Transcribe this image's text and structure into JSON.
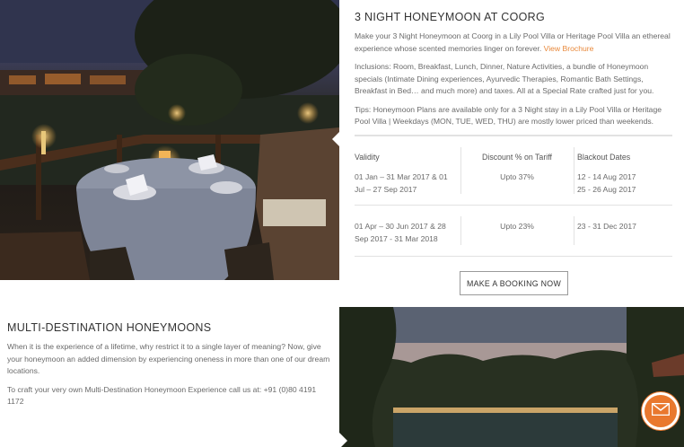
{
  "offer": {
    "title": "3 NIGHT HONEYMOON AT COORG",
    "intro": "Make your 3 Night Honeymoon at Coorg in a Lily Pool Villa or Heritage Pool Villa an ethereal experience whose scented memories linger on forever.",
    "brochure_link": "View Brochure",
    "inclusions": "Inclusions: Room, Breakfast, Lunch, Dinner, Nature Activities, a bundle of Honeymoon specials (Intimate Dining experiences, Ayurvedic Therapies, Romantic Bath Settings, Breakfast in Bed… and much more) and taxes. All at a Special Rate crafted just for you.",
    "tips": "Tips: Honeymoon Plans are available only for a 3 Night stay in a Lily Pool Villa or Heritage Pool Villa | Weekdays (MON, TUE, WED, THU) are mostly lower priced than weekends."
  },
  "table": {
    "headers": [
      "Validity",
      "Discount % on Tariff",
      "Blackout Dates"
    ],
    "rows": [
      {
        "validity_1": "01 Jan – 31 Mar 2017 & 01",
        "validity_2": "Jul – 27 Sep 2017",
        "discount": "Upto 37%",
        "blackout_1": "12 - 14 Aug 2017",
        "blackout_2": "25 - 26 Aug 2017"
      },
      {
        "validity_1": "01 Apr – 30 Jun 2017 & 28",
        "validity_2": "Sep 2017 - 31 Mar 2018",
        "discount": "Upto 23%",
        "blackout_1": "23 - 31 Dec 2017",
        "blackout_2": ""
      }
    ]
  },
  "booking_button": "MAKE A BOOKING NOW",
  "multi": {
    "title": "MULTI-DESTINATION HONEYMOONS",
    "body": "When it is the experience of a lifetime, why restrict it to a single layer of meaning? Now, give your honeymoon an added dimension by experiencing oneness in more than one of our dream locations.",
    "call": "To craft your very own Multi-Destination Honeymoon Experience call us at: +91 (0)80 4191 1172"
  },
  "icons": {
    "mail": "envelope-icon"
  },
  "colors": {
    "accent": "#e9782e",
    "link": "#e8883a"
  }
}
